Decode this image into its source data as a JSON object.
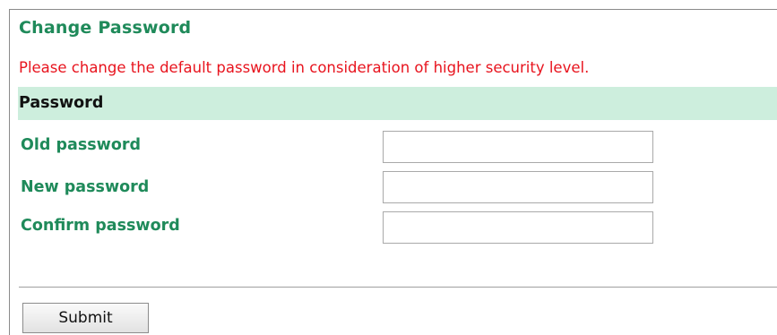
{
  "page": {
    "title": "Change Password",
    "warning": "Please change the default password in consideration of higher security level."
  },
  "section": {
    "title": "Password"
  },
  "fields": {
    "old_password": {
      "label": "Old password",
      "value": ""
    },
    "new_password": {
      "label": "New password",
      "value": ""
    },
    "confirm_password": {
      "label": "Confirm password",
      "value": ""
    }
  },
  "actions": {
    "submit_label": "Submit"
  },
  "colors": {
    "accent_green": "#1f8a5a",
    "warning_red": "#e8141e",
    "section_band": "#cdeedd"
  }
}
